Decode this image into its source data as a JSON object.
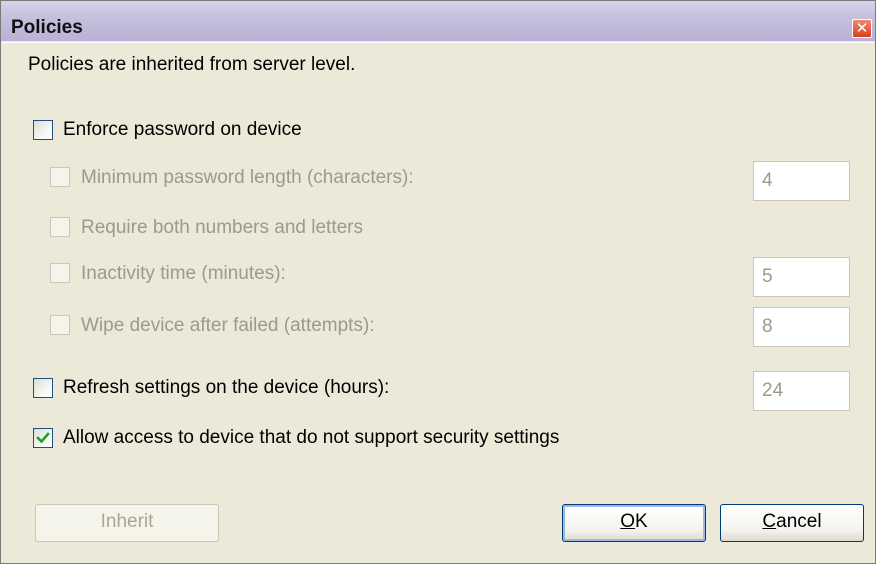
{
  "window": {
    "title": "Policies",
    "close_glyph": "✕"
  },
  "info_text": "Policies are inherited from server level.",
  "settings": {
    "enforce_password": {
      "label": "Enforce password on device",
      "checked": false,
      "enabled": true
    },
    "min_password_length": {
      "label": "Minimum password length (characters):",
      "checked": false,
      "enabled": false,
      "value": "4"
    },
    "require_numbers_letters": {
      "label": "Require both numbers and letters",
      "checked": false,
      "enabled": false
    },
    "inactivity_time": {
      "label": "Inactivity time (minutes):",
      "checked": false,
      "enabled": false,
      "value": "5"
    },
    "wipe_device": {
      "label": "Wipe device after failed (attempts):",
      "checked": false,
      "enabled": false,
      "value": "8"
    },
    "refresh_settings": {
      "label": "Refresh settings on the device (hours):",
      "checked": false,
      "enabled": true,
      "value": "24"
    },
    "allow_access": {
      "label": "Allow access to device that do not support security settings",
      "checked": true,
      "enabled": true
    }
  },
  "buttons": {
    "inherit": "Inherit",
    "ok_mnemonic": "O",
    "ok_rest": "K",
    "cancel_mnemonic": "C",
    "cancel_rest": "ancel"
  },
  "colors": {
    "title_bar": "#c5bfdd",
    "close_button": "#d4411f",
    "check_mark": "#21a121",
    "disabled_text": "#9c9a8c",
    "dialog_background": "#ece9d8"
  },
  "icons": {
    "close": "close-icon",
    "check": "checkmark-icon"
  }
}
